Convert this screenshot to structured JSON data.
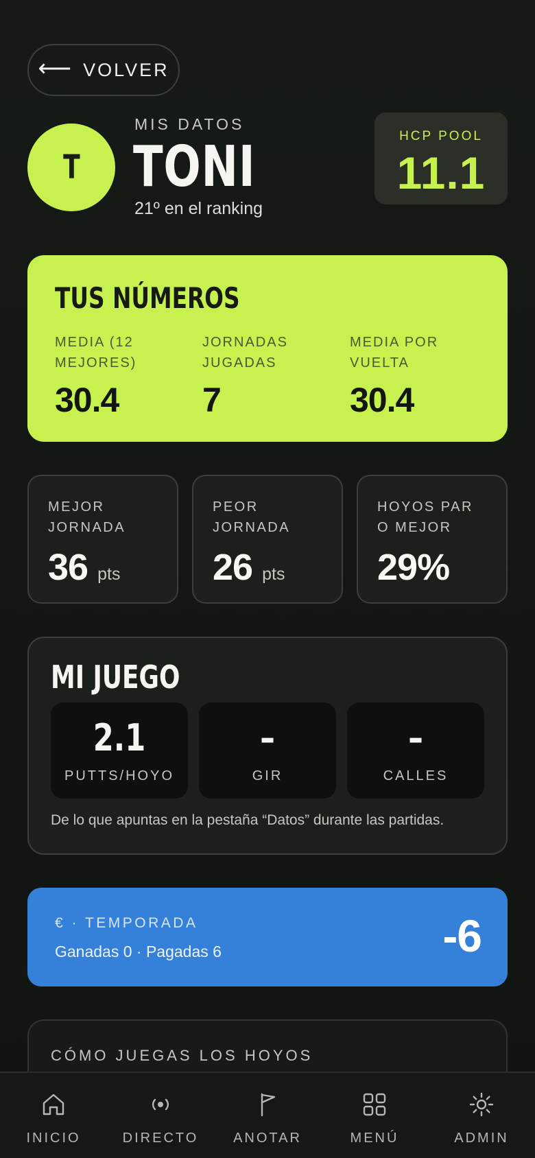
{
  "header": {
    "back_label": "VOLVER",
    "avatar_initial": "T",
    "eyebrow": "MIS DATOS",
    "name": "TONI",
    "rank": "21º en el ranking",
    "hcp_label": "HCP POOL",
    "hcp_value": "11.1"
  },
  "numbers": {
    "title": "TUS NÚMEROS",
    "items": [
      {
        "label": "MEDIA (12 MEJORES)",
        "value": "30.4"
      },
      {
        "label": "JORNADAS JUGADAS",
        "value": "7"
      },
      {
        "label": "MEDIA POR VUELTA",
        "value": "30.4"
      }
    ]
  },
  "stats": [
    {
      "label": "MEJOR JORNADA",
      "value": "36",
      "unit": "pts"
    },
    {
      "label": "PEOR JORNADA",
      "value": "26",
      "unit": "pts"
    },
    {
      "label": "HOYOS PAR O MEJOR",
      "value": "29%",
      "unit": ""
    }
  ],
  "juego": {
    "title": "MI JUEGO",
    "tiles": [
      {
        "value": "2.1",
        "label": "PUTTS/HOYO"
      },
      {
        "value": "–",
        "label": "GIR"
      },
      {
        "value": "–",
        "label": "CALLES"
      }
    ],
    "note": "De lo que apuntas en la pestaña “Datos” durante las partidas."
  },
  "money": {
    "label": "€ · TEMPORADA",
    "summary": "Ganadas 0 · Pagadas 6",
    "value": "-6",
    "color": "#3580d8"
  },
  "holes": {
    "title": "CÓMO JUEGAS LOS HOYOS"
  },
  "tabbar": [
    {
      "label": "INICIO",
      "icon": "home-icon"
    },
    {
      "label": "DIRECTO",
      "icon": "live-icon"
    },
    {
      "label": "ANOTAR",
      "icon": "flag-icon"
    },
    {
      "label": "MENÚ",
      "icon": "grid-icon"
    },
    {
      "label": "ADMIN",
      "icon": "settings-icon"
    }
  ],
  "colors": {
    "accent": "#c7f14f",
    "background": "#131713",
    "money": "#3580d8"
  }
}
